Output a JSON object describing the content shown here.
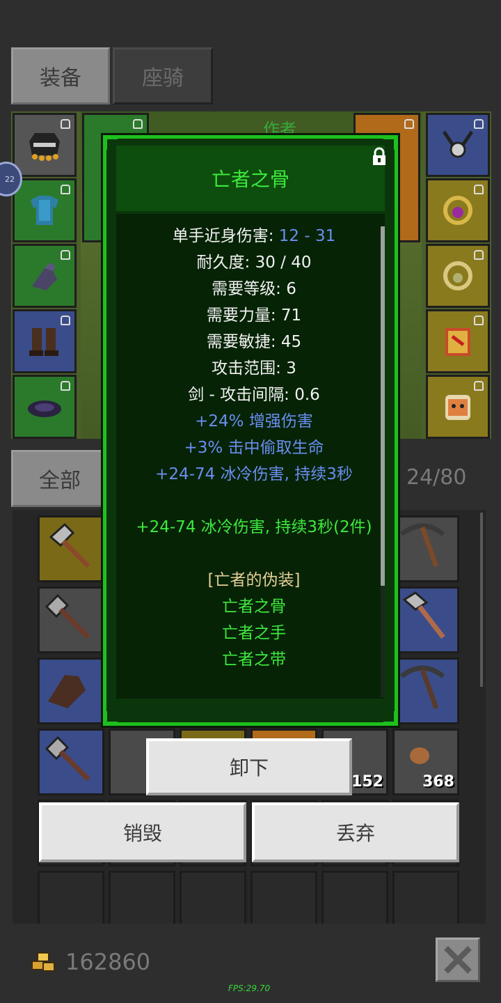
{
  "tabs": {
    "equipment": "装备",
    "mount": "座骑"
  },
  "equip_area": {
    "author_label": "作者"
  },
  "inventory": {
    "filter_label": "全部",
    "count": "24/80",
    "stack_1": "152",
    "stack_2": "368"
  },
  "tooltip": {
    "title": "亡者之骨",
    "lines": [
      {
        "label": "单手近身伤害: ",
        "value": "12 - 31"
      },
      {
        "text": "耐久度: 30 / 40"
      },
      {
        "text": "需要等级: 6"
      },
      {
        "text": "需要力量: 71"
      },
      {
        "text": "需要敏捷: 45"
      },
      {
        "text": "攻击范围: 3"
      },
      {
        "text": "剑 - 攻击间隔: 0.6"
      },
      {
        "text": "+24% 增强伤害"
      },
      {
        "text": "+3% 击中偷取生命"
      },
      {
        "text": "+24-74 冰冷伤害, 持续3秒"
      },
      {
        "text": "+24-74 冰冷伤害, 持续3秒(2件)"
      },
      {
        "text": "[亡者的伪装]"
      },
      {
        "text": "亡者之骨"
      },
      {
        "text": "亡者之手"
      },
      {
        "text": "亡者之带"
      }
    ]
  },
  "buttons": {
    "unequip": "卸下",
    "destroy": "销毁",
    "drop": "丢弃"
  },
  "gold": "162860",
  "fps": "FPS:29.70",
  "side_badge": "22",
  "colors": {
    "tooltip_border": "#1ec01e",
    "title_green": "#3fe83f",
    "affix_blue": "#6a8ef0",
    "set_tan": "#e7cf98"
  }
}
